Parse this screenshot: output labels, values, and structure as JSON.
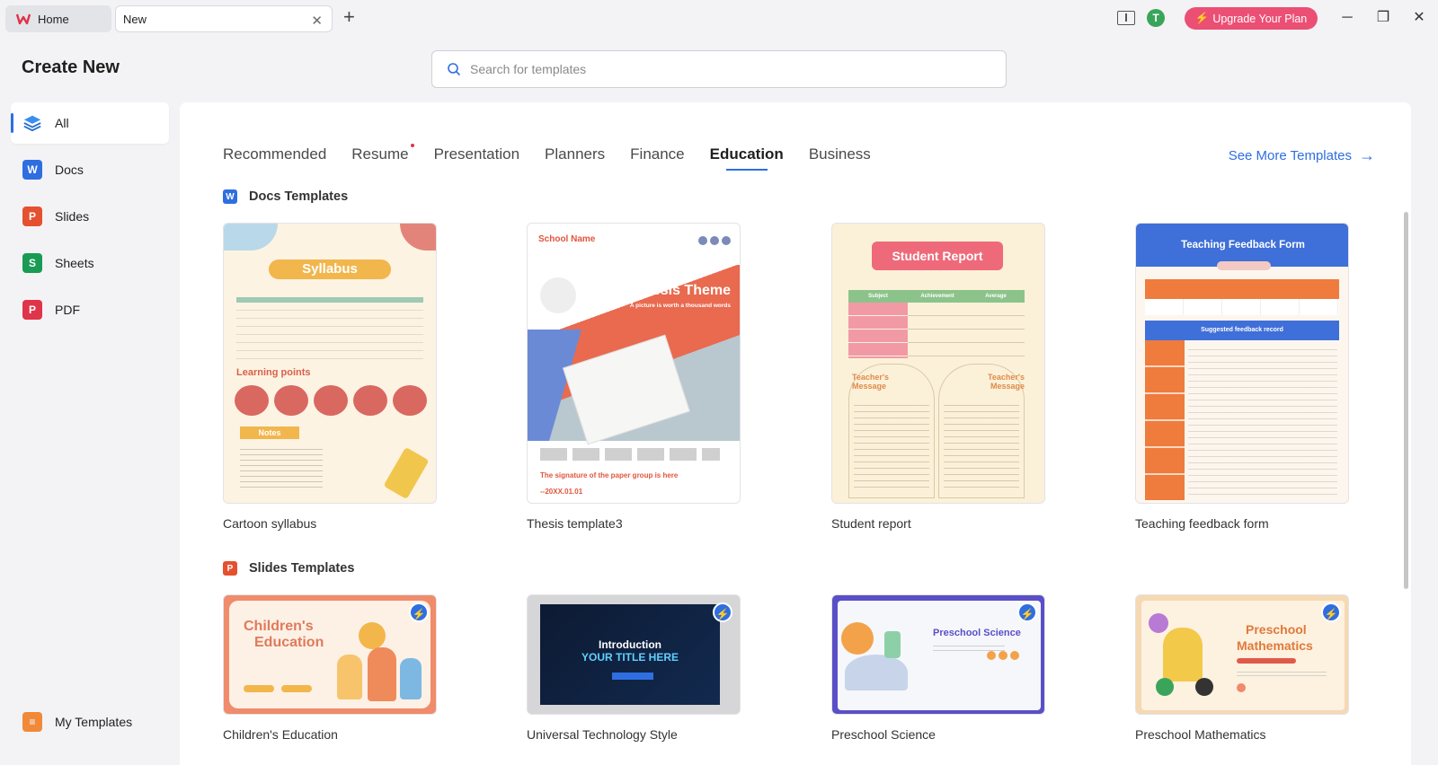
{
  "tabs": {
    "home": "Home",
    "new": "New"
  },
  "titlebar": {
    "avatar_initial": "T",
    "upgrade": "Upgrade Your Plan"
  },
  "sidebar": {
    "title": "Create New",
    "items": [
      {
        "label": "All",
        "icon": "layers-icon"
      },
      {
        "label": "Docs",
        "icon": "docs-icon"
      },
      {
        "label": "Slides",
        "icon": "slides-icon"
      },
      {
        "label": "Sheets",
        "icon": "sheets-icon"
      },
      {
        "label": "PDF",
        "icon": "pdf-icon"
      }
    ],
    "my_templates": "My Templates"
  },
  "search": {
    "placeholder": "Search for templates"
  },
  "categories": [
    "Recommended",
    "Resume",
    "Presentation",
    "Planners",
    "Finance",
    "Education",
    "Business"
  ],
  "active_category": "Education",
  "see_more": "See More Templates",
  "docs_section": {
    "title": "Docs Templates",
    "cards": [
      {
        "label": "Cartoon syllabus",
        "heading": "Syllabus",
        "sub1": "Learning points",
        "sub2": "Notes"
      },
      {
        "label": "Thesis template3",
        "school": "School Name",
        "heading": "Thesis Theme",
        "tagline": "A picture is worth a thousand words",
        "signature": "The signature of the paper group is here",
        "date": "--20XX.01.01"
      },
      {
        "label": "Student report",
        "heading": "Student Report",
        "cols": [
          "Subject",
          "Achievement",
          "Average"
        ],
        "msg": "Teacher's Message"
      },
      {
        "label": "Teaching feedback form",
        "heading": "Teaching Feedback Form",
        "bar": "Suggested feedback record"
      }
    ]
  },
  "slides_section": {
    "title": "Slides Templates",
    "cards": [
      {
        "label": "Children's Education",
        "heading1": "Children's",
        "heading2": "Education"
      },
      {
        "label": "Universal Technology Style",
        "heading1": "Introduction",
        "heading2": "YOUR TITLE HERE"
      },
      {
        "label": "Preschool Science",
        "heading1": "Preschool Science"
      },
      {
        "label": "Preschool Mathematics",
        "heading1": "Preschool",
        "heading2": "Mathematics"
      }
    ]
  },
  "colors": {
    "accent": "#2f6ee0",
    "upgrade": "#ec4f74",
    "docs": "#2f6ee0",
    "slides": "#e5502f",
    "sheets": "#1a9b54",
    "pdf": "#e0344a"
  }
}
